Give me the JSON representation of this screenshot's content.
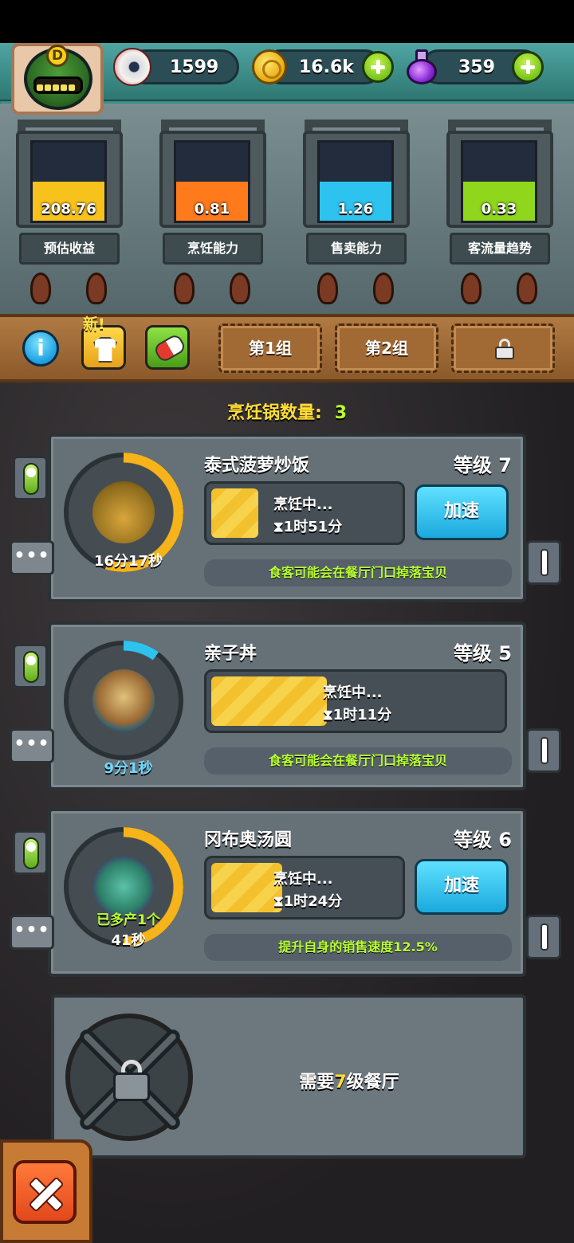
{
  "header": {
    "avatar_badge": "D",
    "eyeballs": "1599",
    "coins": "16.6k",
    "potions": "359"
  },
  "stats": [
    {
      "value": "208.76",
      "label": "预估收益",
      "color": "#f7c21c",
      "fill": 0.5
    },
    {
      "value": "0.81",
      "label": "烹饪能力",
      "color": "#ff7a1a",
      "fill": 0.5
    },
    {
      "value": "1.26",
      "label": "售卖能力",
      "color": "#2ec3ee",
      "fill": 0.5
    },
    {
      "value": "0.33",
      "label": "客流量趋势",
      "color": "#8fd61d",
      "fill": 0.5
    }
  ],
  "toolbar": {
    "new_label": "新!",
    "tabs": [
      "第1组",
      "第2组"
    ]
  },
  "pot_count_label": "烹饪锅数量:",
  "pot_count": "3",
  "pots": [
    {
      "name": "泰式菠萝炒饭",
      "level": "等级 7",
      "status": "烹饪中...",
      "time": "⧗1时51分",
      "timer": "16分17秒",
      "speed": "加速",
      "bonus": "食客可能会在餐厅门口掉落宝贝",
      "progress": 0.25
    },
    {
      "name": "亲子丼",
      "level": "等级 5",
      "status": "烹饪中...",
      "time": "⧗1时11分",
      "timer": "9分1秒",
      "bonus": "食客可能会在餐厅门口掉落宝贝",
      "progress": 0.4
    },
    {
      "name": "冈布奥汤圆",
      "level": "等级 6",
      "status": "烹饪中...",
      "time": "⧗1时24分",
      "extra": "已多产1个",
      "timer": "41秒",
      "speed": "加速",
      "bonus": "提升自身的销售速度12.5%",
      "progress": 0.38
    }
  ],
  "locked": {
    "prefix": "需要",
    "level": "7",
    "suffix": "级餐厅"
  },
  "icons": [
    "eyeball-icon",
    "coin-icon",
    "potion-icon",
    "plus-icon",
    "info-icon",
    "shirt-icon",
    "pill-icon",
    "lock-icon",
    "close-icon",
    "arrow-up-icon",
    "more-icon"
  ]
}
